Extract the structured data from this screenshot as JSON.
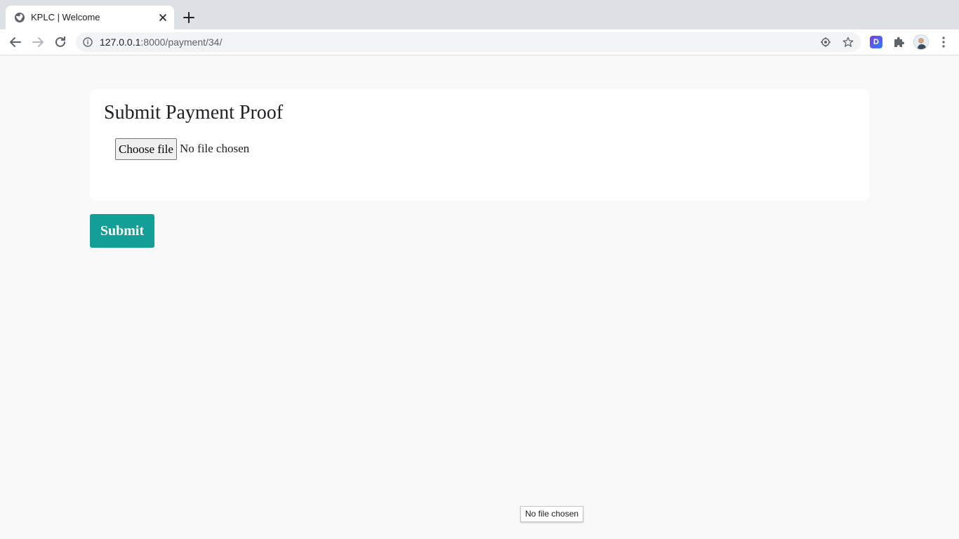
{
  "browser": {
    "tab": {
      "title": "KPLC | Welcome",
      "favicon": "globe-icon"
    },
    "address": {
      "host": "127.0.0.1",
      "rest": ":8000/payment/34/"
    },
    "toolbar_icons": [
      "back-icon",
      "forward-icon",
      "reload-icon",
      "site-info-icon",
      "location-icon",
      "star-icon",
      "extension-d-icon",
      "puzzle-icon",
      "profile-avatar",
      "menu-icon"
    ],
    "extension_badge": "D"
  },
  "page": {
    "card_title": "Submit Payment Proof",
    "file_input": {
      "button_label": "Choose file",
      "status": "No file chosen"
    },
    "submit_label": "Submit",
    "tooltip": "No file chosen"
  },
  "colors": {
    "accent": "#139e96",
    "page_bg": "#f9f9f9",
    "tabstrip_bg": "#dee1e6"
  }
}
